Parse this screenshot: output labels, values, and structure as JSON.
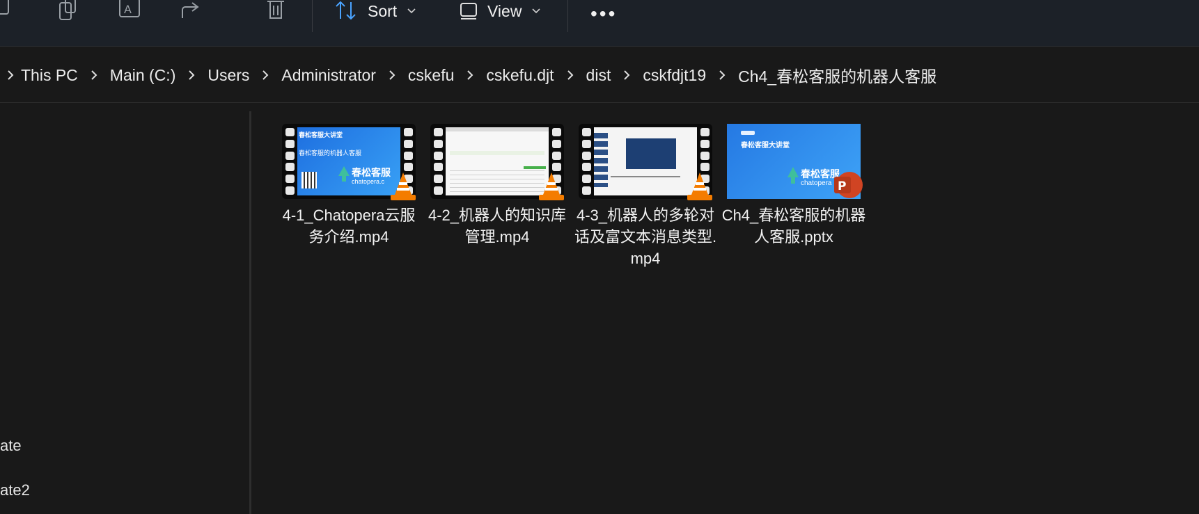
{
  "toolbar": {
    "icons": [
      "copy-icon",
      "paste-icon",
      "rename-icon",
      "share-icon",
      "delete-icon"
    ],
    "sort_label": "Sort",
    "view_label": "View",
    "more_label": "•••"
  },
  "address": {
    "crumbs": [
      "This PC",
      "Main (C:)",
      "Users",
      "Administrator",
      "cskefu",
      "cskefu.djt",
      "dist",
      "cskfdjt19",
      "Ch4_春松客服的机器人客服"
    ]
  },
  "nav": {
    "items": [
      "ate",
      "ate2"
    ]
  },
  "files": [
    {
      "name": "4-1_Chatopera云服务介绍.mp4",
      "type": "video",
      "thumb_title": "春松客服大讲堂",
      "thumb_sub": "春松客服的机器人客服",
      "thumb_brand": "春松客服",
      "thumb_site": "chatopera.c"
    },
    {
      "name": "4-2_机器人的知识库管理.mp4",
      "type": "video"
    },
    {
      "name": "4-3_机器人的多轮对话及富文本消息类型.mp4",
      "type": "video"
    },
    {
      "name": "Ch4_春松客服的机器人客服.pptx",
      "type": "pptx",
      "thumb_title": "春松客服大讲堂",
      "thumb_brand": "春松客服",
      "thumb_site": "chatopera"
    }
  ],
  "colors": {
    "accent": "#1e88e5",
    "vlc": "#f47c00",
    "ppt": "#d04423"
  }
}
